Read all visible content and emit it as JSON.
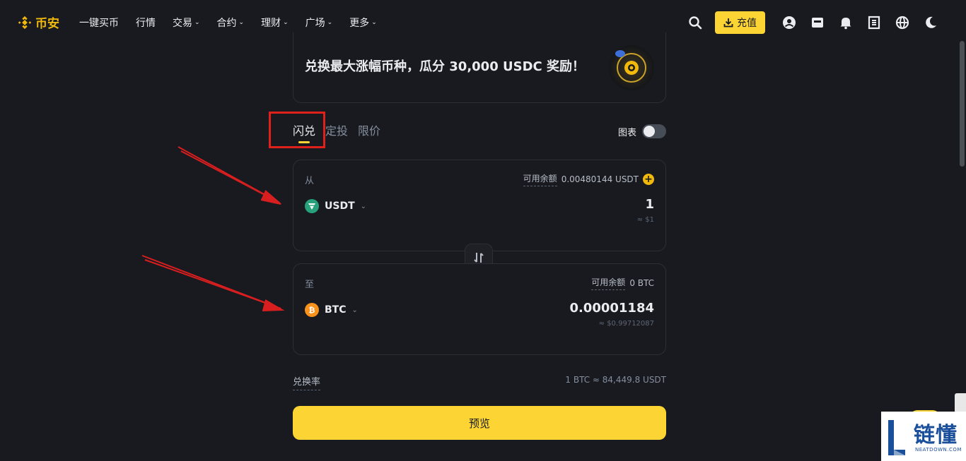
{
  "brand": {
    "name": "币安",
    "color": "#f0b90b"
  },
  "nav": [
    {
      "label": "一键买币",
      "dropdown": false
    },
    {
      "label": "行情",
      "dropdown": false
    },
    {
      "label": "交易",
      "dropdown": true
    },
    {
      "label": "合约",
      "dropdown": true
    },
    {
      "label": "理财",
      "dropdown": true
    },
    {
      "label": "广场",
      "dropdown": true
    },
    {
      "label": "更多",
      "dropdown": true
    }
  ],
  "header": {
    "deposit_label": "充值",
    "icons": [
      "search-icon",
      "user-icon",
      "wallet-icon",
      "bell-icon",
      "download-icon",
      "globe-icon",
      "moon-icon"
    ]
  },
  "banner": {
    "text": "兑换最大涨幅币种，瓜分 30,000 USDC 奖励！"
  },
  "tabs": [
    {
      "label": "闪兑",
      "active": true
    },
    {
      "label": "定投",
      "active": false
    },
    {
      "label": "限价",
      "active": false
    }
  ],
  "chart_toggle": {
    "label": "图表",
    "on": false
  },
  "from": {
    "label": "从",
    "balance_key": "可用余额",
    "balance_value": "0.00480144 USDT",
    "coin": "USDT",
    "amount": "1",
    "approx": "≈ $1"
  },
  "to": {
    "label": "至",
    "balance_key": "可用余额",
    "balance_value": "0 BTC",
    "coin": "BTC",
    "amount": "0.00001184",
    "approx": "≈ $0.99712087"
  },
  "rate": {
    "label": "兑换率",
    "value": "1 BTC ≈ 84,449.8 USDT"
  },
  "preview_label": "预览",
  "watermark": {
    "text": "链懂",
    "sub": "NEATDOWN.COM"
  },
  "colors": {
    "accent": "#fcd535",
    "background": "#181a20",
    "annotation": "#e0201b"
  }
}
